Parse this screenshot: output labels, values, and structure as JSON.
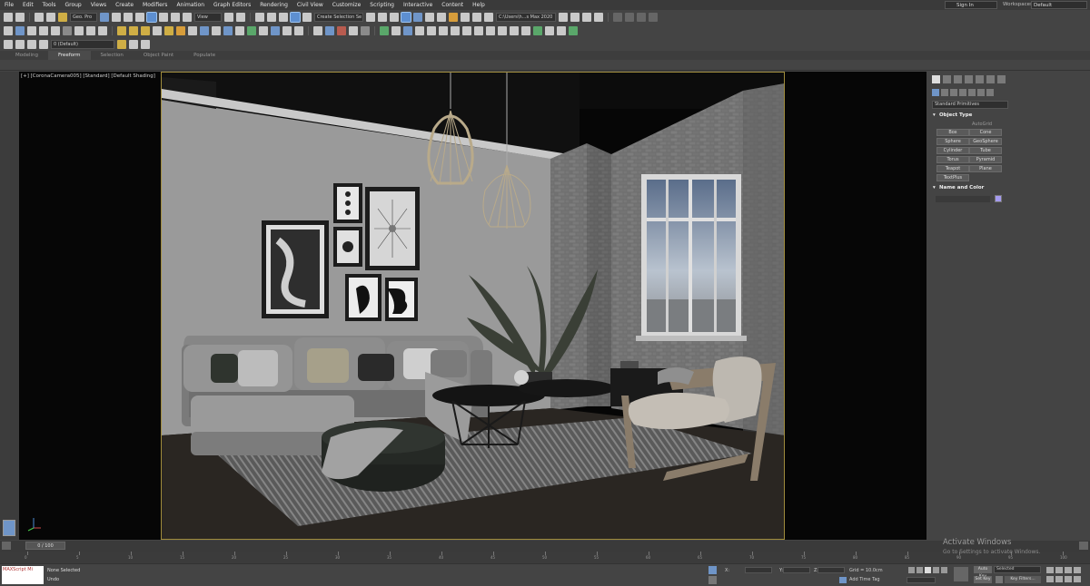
{
  "menu": [
    "File",
    "Edit",
    "Tools",
    "Group",
    "Views",
    "Create",
    "Modifiers",
    "Animation",
    "Graph Editors",
    "Rendering",
    "Civil View",
    "Customize",
    "Scripting",
    "Interactive",
    "Content",
    "Help"
  ],
  "account": {
    "sign_in": "Sign In",
    "workspaces_label": "Workspaces:",
    "workspace_value": "Default"
  },
  "toolbar": {
    "undo_dd": "Geo. Pro",
    "view_dd": "View",
    "selection_set": "Create Selection Se",
    "project_path": "C:\\Users\\h...s Max 2020",
    "layer_dd": "0 (Default)"
  },
  "ribbon_tabs": [
    "Modeling",
    "Freeform",
    "Selection",
    "Object Paint",
    "Populate"
  ],
  "viewport": {
    "label": "[+] [CoronaCamera005] [Standard] [Default Shading]"
  },
  "command_panel": {
    "category_dd": "Standard Primitives",
    "object_type_title": "Object Type",
    "autogrid": "AutoGrid",
    "object_buttons": [
      "Box",
      "Cone",
      "Sphere",
      "GeoSphere",
      "Cylinder",
      "Tube",
      "Torus",
      "Pyramid",
      "Teapot",
      "Plane",
      "TextPlus"
    ],
    "name_color_title": "Name and Color",
    "swatch_color": "#a59bf0"
  },
  "time": {
    "frame": "0 / 100",
    "ticks": [
      0,
      5,
      10,
      15,
      20,
      25,
      30,
      35,
      40,
      45,
      50,
      55,
      60,
      65,
      70,
      75,
      80,
      85,
      90,
      95,
      100
    ]
  },
  "status": {
    "maxscript": "MAXScript Mi",
    "selection": "None Selected",
    "undo": "Undo",
    "x_label": "X:",
    "y_label": "Y:",
    "z_label": "Z:",
    "grid": "Grid = 10.0cm",
    "add_time_tag": "Add Time Tag",
    "auto_key": "Auto Key",
    "selected_dd": "Selected",
    "set_key": "Set Key",
    "key_filters": "Key Filters..."
  },
  "watermark": {
    "title": "Activate Windows",
    "subtitle": "Go to Settings to activate Windows."
  }
}
